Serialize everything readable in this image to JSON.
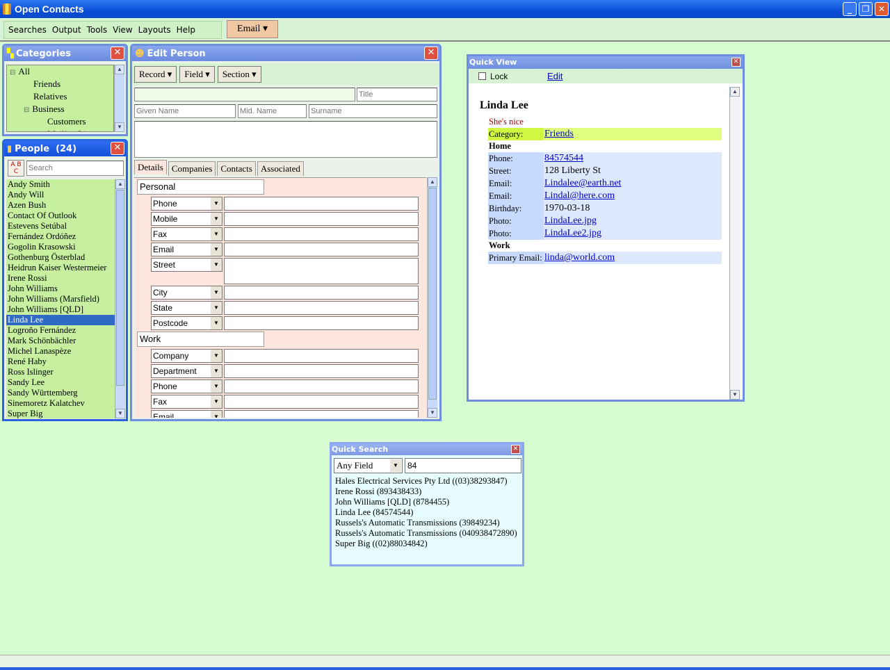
{
  "app": {
    "title": "Open Contacts"
  },
  "menu": [
    "Searches",
    "Output",
    "Tools",
    "View",
    "Layouts",
    "Help"
  ],
  "email_button": "Email ▾",
  "categories": {
    "title": "Categories",
    "items": [
      {
        "label": "All",
        "level": 0,
        "exp": "⊟"
      },
      {
        "label": "Friends",
        "level": 1
      },
      {
        "label": "Relatives",
        "level": 1
      },
      {
        "label": "Business",
        "level": 1,
        "exp": "⊟"
      },
      {
        "label": "Customers",
        "level": 2
      },
      {
        "label": "Mailing List",
        "level": 2
      }
    ]
  },
  "people": {
    "title": "People  (24)",
    "search_placeholder": "Search",
    "sort_icon_text": "A B C",
    "selected": "Linda Lee",
    "items": [
      "Andy Smith",
      "Andy Will",
      "Azen Bush",
      "Contact Of Outlook",
      "Estevens Setúbal",
      "Fernández Ordóñez",
      "Gogolin Krasowski",
      "Gothenburg Österblad",
      "Heidrun Kaiser Westermeier",
      "Irene Rossi",
      "John Williams",
      "John Williams (Marsfield)",
      "John Williams [QLD]",
      "Linda Lee",
      "Logroño Fernández",
      "Mark Schönbächler",
      "Michel Lanaspèze",
      "René Haby",
      "Ross  Islinger",
      "Sandy Lee",
      "Sandy Württemberg",
      "Sinemoretz Kalatchev",
      "Super Big"
    ]
  },
  "edit": {
    "title": "Edit Person",
    "toolbar": [
      "Record ▾",
      "Field ▾",
      "Section ▾"
    ],
    "placeholders": {
      "title": "Title",
      "given": "Given Name",
      "mid": "Mid. Name",
      "surname": "Surname"
    },
    "tabs": [
      "Details",
      "Companies",
      "Contacts",
      "Associated"
    ],
    "sections": [
      {
        "name": "Personal",
        "fields": [
          "Phone",
          "Mobile",
          "Fax",
          "Email",
          "Street",
          "City",
          "State",
          "Postcode"
        ]
      },
      {
        "name": "Work",
        "fields": [
          "Company",
          "Department",
          "Phone",
          "Fax",
          "Email"
        ]
      }
    ]
  },
  "quick_view": {
    "title": "Quick View",
    "lock": "Lock",
    "edit": "Edit",
    "name": "Linda Lee",
    "note": "She's nice",
    "category": {
      "label": "Category:",
      "value": "Friends"
    },
    "home_heading": "Home",
    "home": [
      {
        "label": "Phone:",
        "value": "84574544",
        "link": true
      },
      {
        "label": "Street:",
        "value": "128 Liberty St",
        "link": false
      },
      {
        "label": "Email:",
        "value": "Lindalee@earth.net",
        "link": true
      },
      {
        "label": "Email:",
        "value": "Lindal@here.com",
        "link": true
      },
      {
        "label": "Birthday:",
        "value": "1970-03-18",
        "link": false
      },
      {
        "label": "Photo:",
        "value": "LindaLee.jpg",
        "link": true
      },
      {
        "label": "Photo:",
        "value": "LindaLee2.jpg",
        "link": true
      }
    ],
    "work_heading": "Work",
    "work": [
      {
        "label": "Primary Email:",
        "value": "linda@world.com",
        "link": true
      }
    ]
  },
  "quick_search": {
    "title": "Quick Search",
    "field": "Any Field",
    "query": "84",
    "results": [
      "Hales Electrical Services Pty Ltd ((03)38293847)",
      "Irene Rossi (893438433)",
      "John Williams [QLD] (8784455)",
      "Linda Lee (84574544)",
      "Russels's Automatic Transmissions (39849234)",
      "Russels's Automatic Transmissions (040938472890)",
      "Super Big ((02)88034842)"
    ]
  },
  "colors": {
    "desktop": "#d6fbd0",
    "title_blue": "#0a4fd8",
    "selection": "#316ac5",
    "category_row": "#e0ff80",
    "home_rows": "#dde8fc"
  }
}
